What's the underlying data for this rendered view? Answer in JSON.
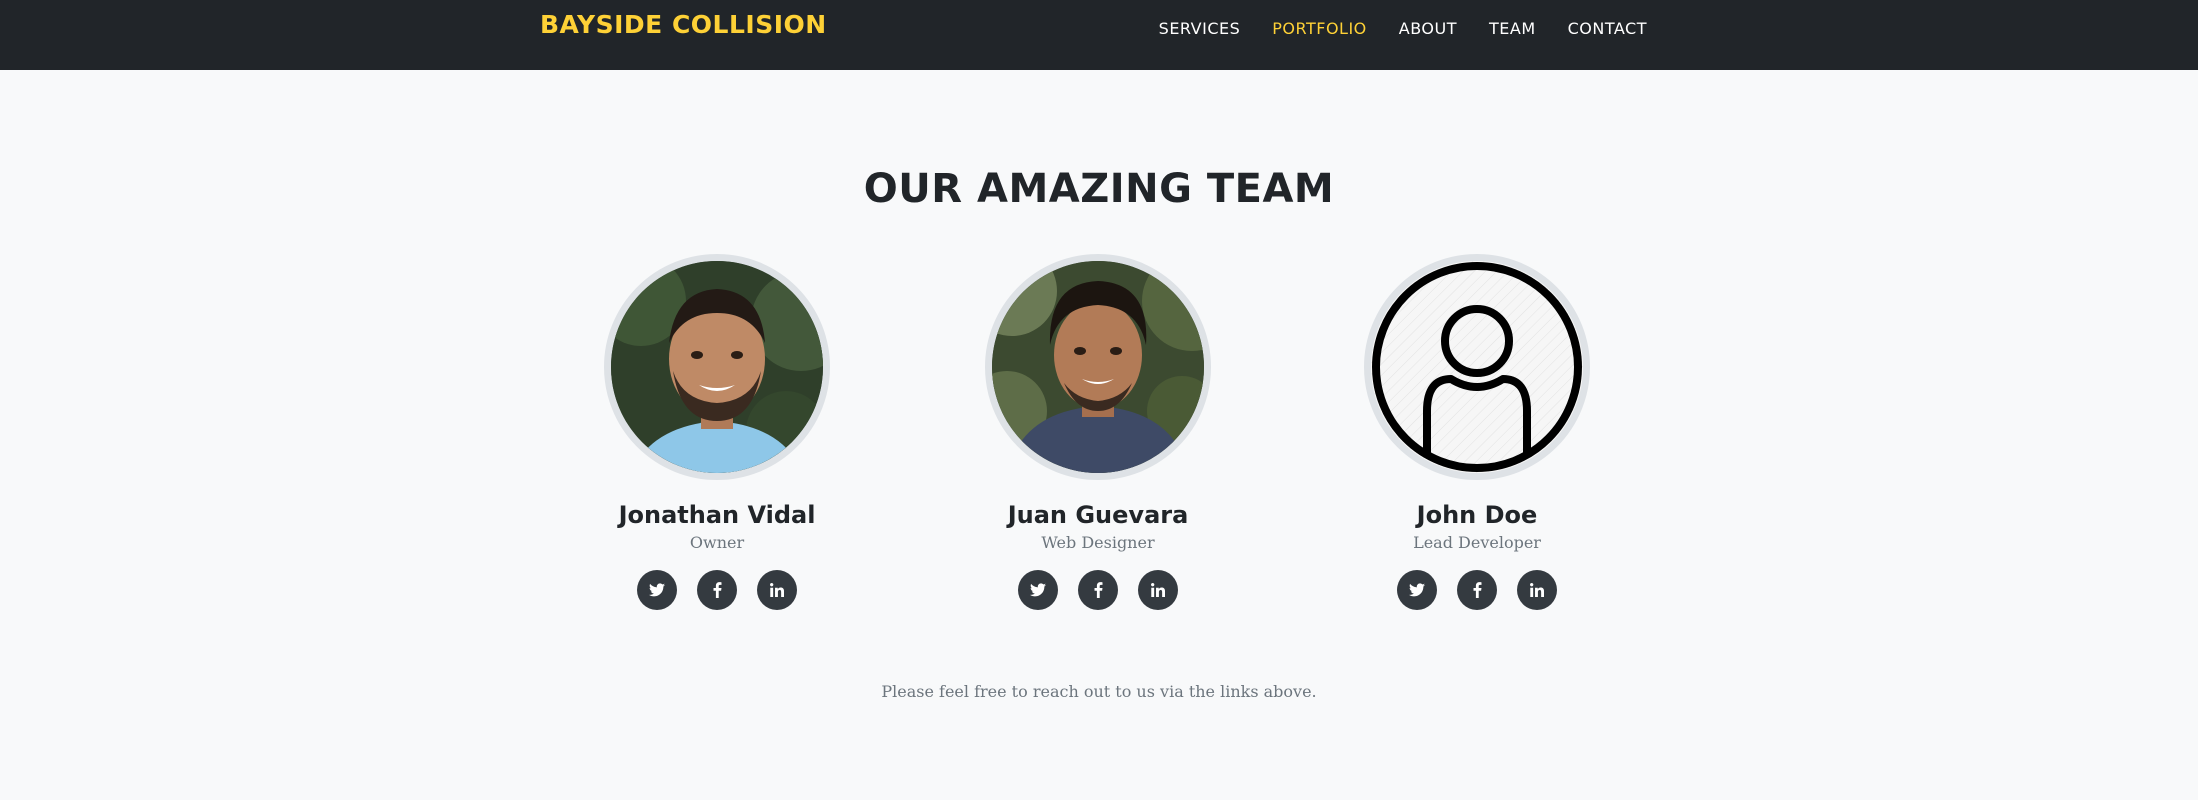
{
  "navbar": {
    "brand": "BAYSIDE COLLISION",
    "links": [
      {
        "label": "SERVICES",
        "active": false
      },
      {
        "label": "PORTFOLIO",
        "active": true
      },
      {
        "label": "ABOUT",
        "active": false
      },
      {
        "label": "TEAM",
        "active": false
      },
      {
        "label": "CONTACT",
        "active": false
      }
    ]
  },
  "team": {
    "heading": "OUR AMAZING TEAM",
    "members": [
      {
        "name": "Jonathan Vidal",
        "role": "Owner",
        "photo": "photo-man-smiling-outdoors",
        "socials": [
          "twitter-icon",
          "facebook-icon",
          "linkedin-icon"
        ]
      },
      {
        "name": "Juan Guevara",
        "role": "Web Designer",
        "photo": "photo-man-smiling-outdoors",
        "socials": [
          "twitter-icon",
          "facebook-icon",
          "linkedin-icon"
        ]
      },
      {
        "name": "John Doe",
        "role": "Lead Developer",
        "photo": "default-user-icon",
        "socials": [
          "twitter-icon",
          "facebook-icon",
          "linkedin-icon"
        ]
      }
    ],
    "note": "Please feel free to reach out to us via the links above."
  },
  "colors": {
    "navbar_bg": "#212529",
    "accent": "#fed136",
    "page_bg": "#f8f9fa",
    "social_bg": "#343a40",
    "muted_text": "#6c757d"
  }
}
